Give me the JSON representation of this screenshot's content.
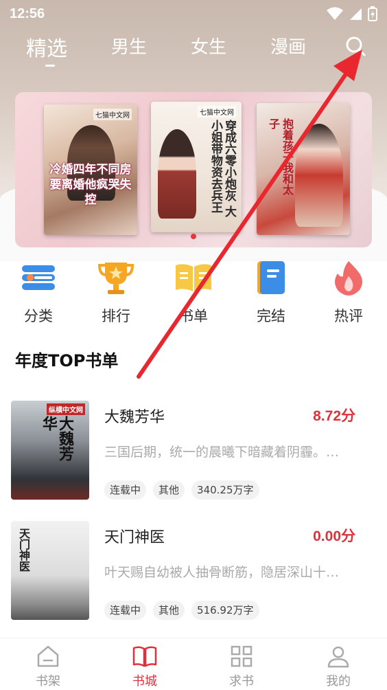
{
  "status_bar": {
    "time": "12:56"
  },
  "top_tabs": [
    {
      "label": "精选",
      "active": true
    },
    {
      "label": "男生",
      "active": false
    },
    {
      "label": "女生",
      "active": false
    },
    {
      "label": "漫画",
      "active": false
    }
  ],
  "search": {
    "icon": "search-icon"
  },
  "banner": {
    "covers": [
      {
        "brand": "七猫中文网",
        "title": "冷婚四年不同房 要离婚他疯哭失控"
      },
      {
        "brand": "七猫中文网",
        "title": "穿成六零小炮灰 大小姐带物资去兵王"
      },
      {
        "brand": "",
        "title": "抱着孩子我和太子"
      }
    ],
    "active_dot": 0
  },
  "categories": [
    {
      "label": "分类",
      "icon": "list-icon"
    },
    {
      "label": "排行",
      "icon": "trophy-icon"
    },
    {
      "label": "书单",
      "icon": "open-book-icon"
    },
    {
      "label": "完结",
      "icon": "notebook-icon"
    },
    {
      "label": "热评",
      "icon": "flame-icon"
    }
  ],
  "section": {
    "title": "年度TOP书单"
  },
  "books": [
    {
      "title": "大魏芳华",
      "score": "8.72分",
      "desc": "三国后期，统一的晨曦下暗藏着阴霾。…",
      "tags": [
        "连载中",
        "其他",
        "340.25万字"
      ],
      "cover_text": "大魏芳华",
      "cover_brand": "纵横中文网"
    },
    {
      "title": "天门神医",
      "score": "0.00分",
      "desc": "叶天赐自幼被人抽骨断筋，隐居深山十…",
      "tags": [
        "连载中",
        "其他",
        "516.92万字"
      ],
      "cover_text": "天门神医"
    }
  ],
  "bottom_nav": [
    {
      "label": "书架",
      "icon": "bookshelf-icon",
      "active": false
    },
    {
      "label": "书城",
      "icon": "book-icon",
      "active": true
    },
    {
      "label": "求书",
      "icon": "grid-icon",
      "active": false
    },
    {
      "label": "我的",
      "icon": "profile-icon",
      "active": false
    }
  ],
  "colors": {
    "accent": "#e0303a",
    "annotation_arrow": "#e8272f"
  }
}
